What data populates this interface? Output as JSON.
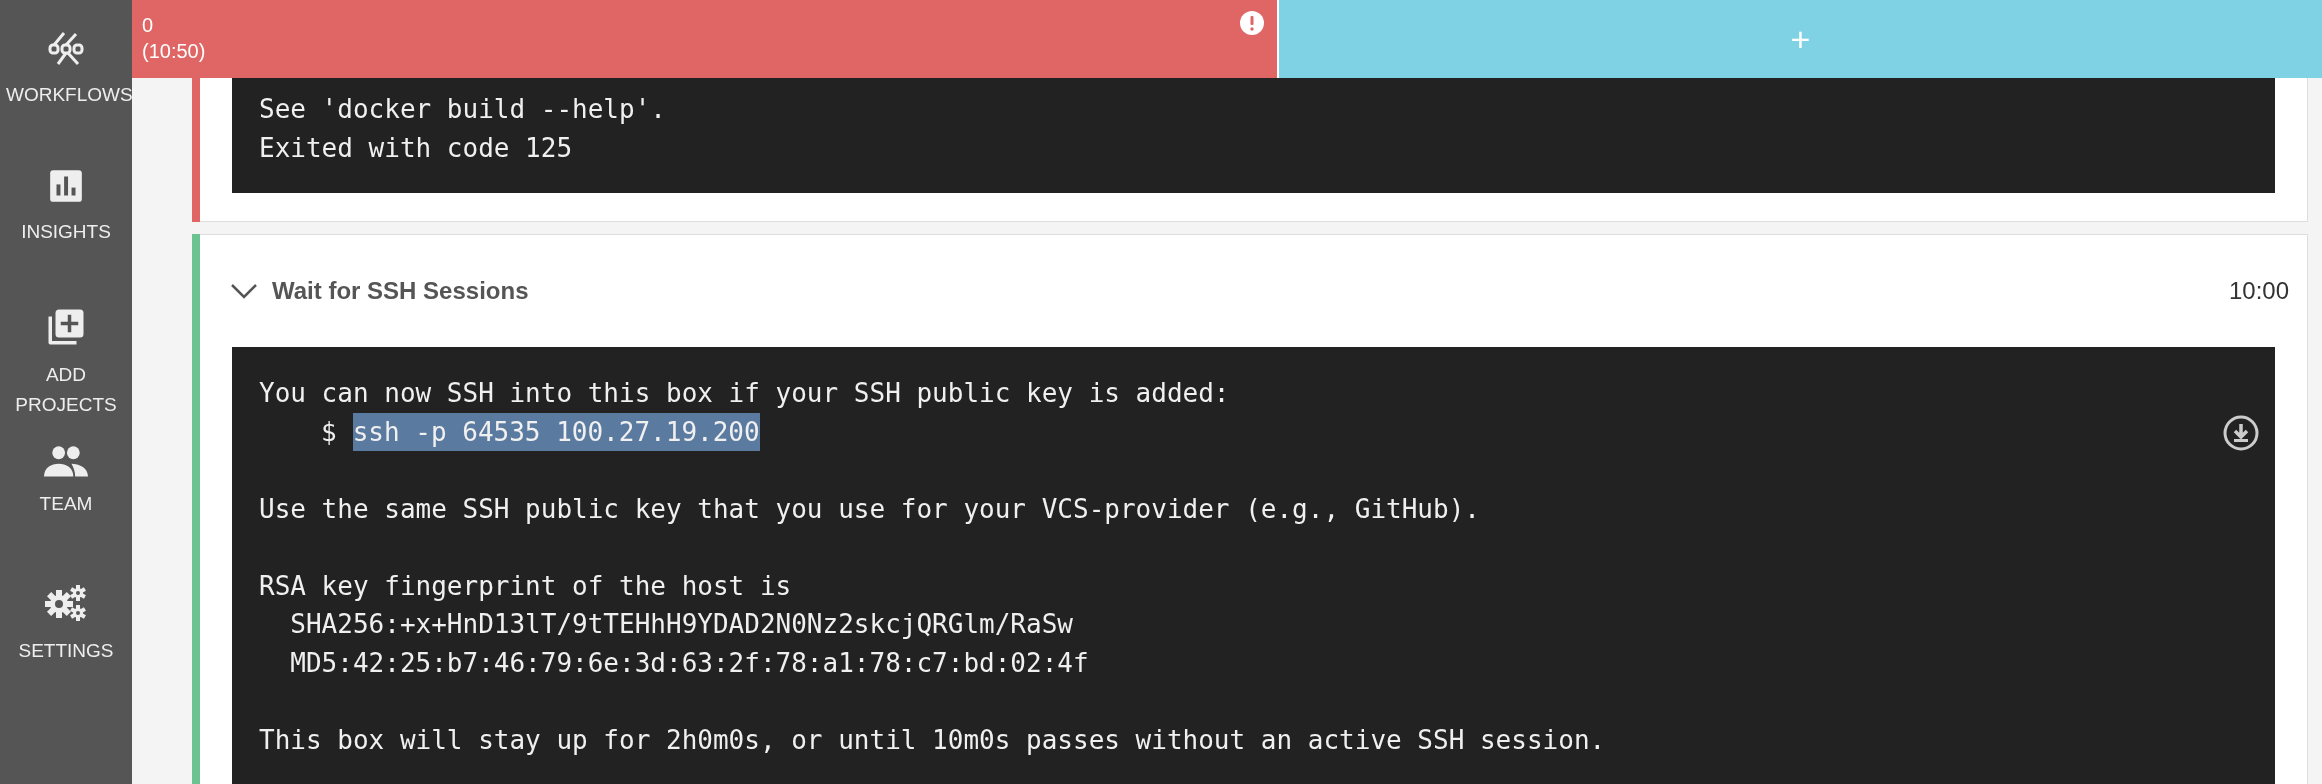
{
  "sidebar": {
    "items": [
      {
        "label": "WORKFLOWS",
        "kind": "workflows"
      },
      {
        "label": "INSIGHTS",
        "kind": "insights"
      },
      {
        "label": "ADD PROJECTS",
        "kind": "add"
      },
      {
        "label": "TEAM",
        "kind": "team"
      },
      {
        "label": "SETTINGS",
        "kind": "settings"
      }
    ]
  },
  "job_tabs": [
    {
      "kind": "job",
      "color": "#e06666",
      "label": "0",
      "duration": "(10:50)"
    },
    {
      "kind": "add",
      "label": "+"
    }
  ],
  "steps": [
    {
      "color": "#e06666",
      "output": [
        {
          "kind": "text",
          "text": "See 'docker build --help'."
        },
        {
          "kind": "text",
          "text": "Exited with code 125"
        }
      ]
    },
    {
      "color": "#6cc392",
      "expanded": true,
      "title": "Wait for SSH Sessions",
      "duration": "10:00",
      "output": [
        {
          "kind": "text",
          "text": "You can now SSH into this box if your SSH public key is added:"
        },
        {
          "kind": "command",
          "prompt": "$",
          "text": "ssh -p 64535 100.27.19.200",
          "selected": true
        },
        {
          "kind": "blank"
        },
        {
          "kind": "text",
          "text": "Use the same SSH public key that you use for your VCS-provider (e.g., GitHub)."
        },
        {
          "kind": "blank"
        },
        {
          "kind": "text",
          "text": "RSA key fingerprint of the host is"
        },
        {
          "kind": "text",
          "text": "  SHA256:+x+HnD13lT/9tTEHhH9YDAD2N0Nz2skcjQRGlm/RaSw"
        },
        {
          "kind": "text",
          "text": "  MD5:42:25:b7:46:79:6e:3d:63:2f:78:a1:78:c7:bd:02:4f"
        },
        {
          "kind": "blank"
        },
        {
          "kind": "text",
          "text": "This box will stay up for 2h0m0s, or until 10m0s passes without an active SSH session."
        }
      ]
    }
  ]
}
